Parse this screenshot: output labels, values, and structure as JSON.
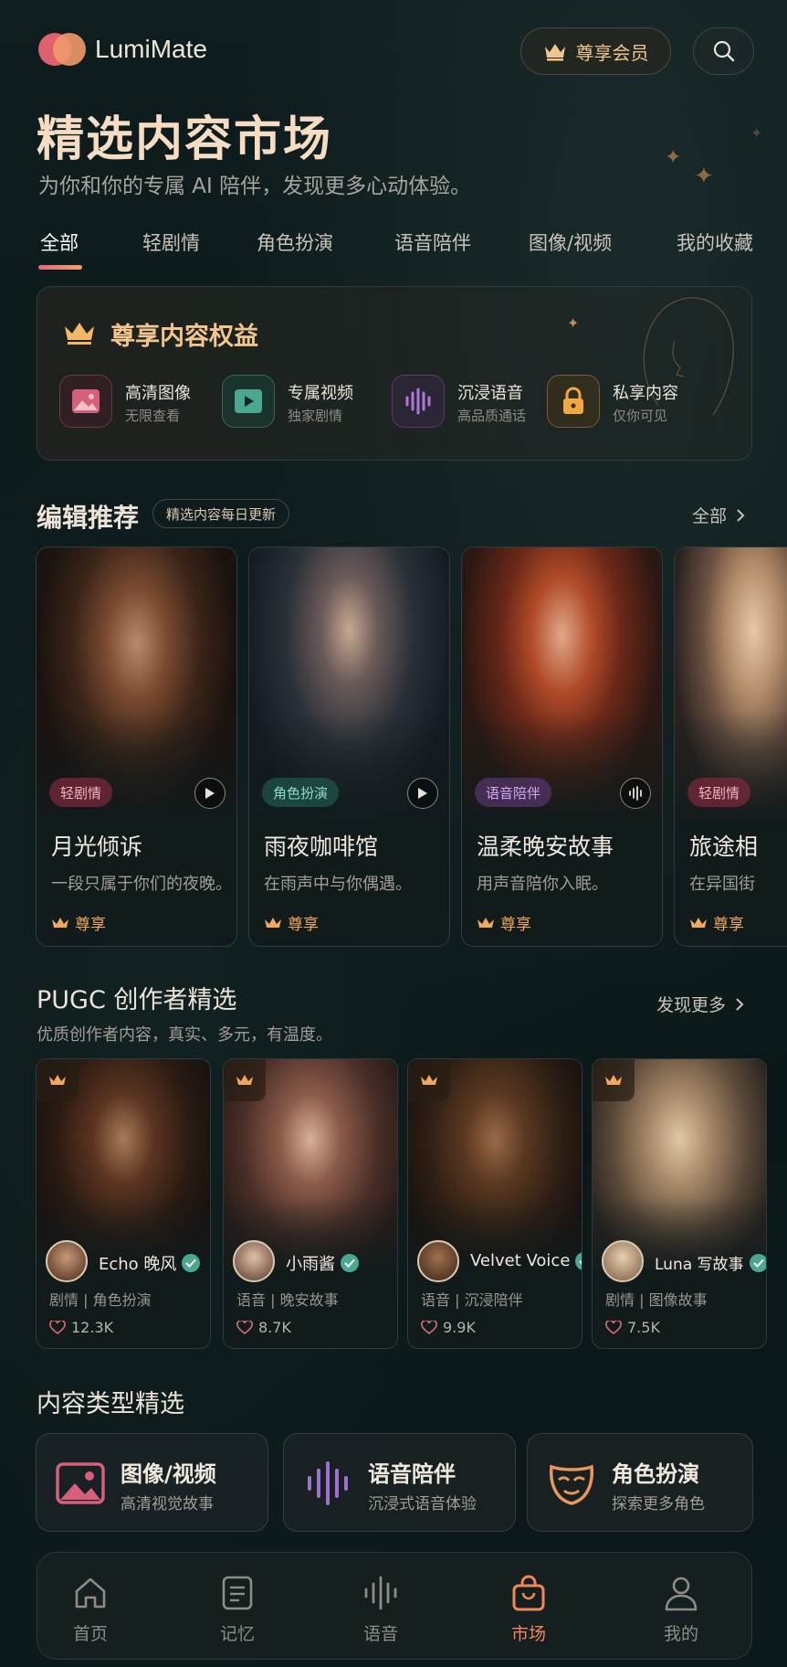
{
  "app": {
    "brand": "LumiMate"
  },
  "header": {
    "vip_label": "尊享会员"
  },
  "page": {
    "title": "精选内容市场",
    "subtitle": "为你和你的专属 AI 陪伴，发现更多心动体验。"
  },
  "tabs": [
    {
      "label": "全部",
      "active": true
    },
    {
      "label": "轻剧情"
    },
    {
      "label": "角色扮演"
    },
    {
      "label": "语音陪伴"
    },
    {
      "label": "图像/视频"
    },
    {
      "label": "我的收藏"
    }
  ],
  "benefits": {
    "title": "尊享内容权益",
    "items": [
      {
        "name": "高清图像",
        "sub": "无限查看",
        "icon": "image-icon"
      },
      {
        "name": "专属视频",
        "sub": "独家剧情",
        "icon": "play-icon"
      },
      {
        "name": "沉浸语音",
        "sub": "高品质通话",
        "icon": "waveform-icon"
      },
      {
        "name": "私享内容",
        "sub": "仅你可见",
        "icon": "lock-icon"
      }
    ]
  },
  "editor": {
    "title": "编辑推荐",
    "pill": "精选内容每日更新",
    "more": "全部",
    "cards": [
      {
        "tag": "轻剧情",
        "name": "月光倾诉",
        "desc": "一段只属于你们的夜晚。",
        "vip": "尊享",
        "action_icon": "play-icon"
      },
      {
        "tag": "角色扮演",
        "name": "雨夜咖啡馆",
        "desc": "在雨声中与你偶遇。",
        "vip": "尊享",
        "action_icon": "play-icon"
      },
      {
        "tag": "语音陪伴",
        "name": "温柔晚安故事",
        "desc": "用声音陪你入眠。",
        "vip": "尊享",
        "action_icon": "waveform-icon"
      },
      {
        "tag": "轻剧情",
        "name": "旅途相",
        "desc": "在异国街",
        "vip": "尊享",
        "action_icon": ""
      }
    ]
  },
  "pugc": {
    "title": "PUGC 创作者精选",
    "subtitle": "优质创作者内容，真实、多元，有温度。",
    "more": "发现更多",
    "cards": [
      {
        "author": "Echo 晚风",
        "cats": "剧情 | 角色扮演",
        "likes": "12.3K"
      },
      {
        "author": "小雨酱",
        "cats": "语音 | 晚安故事",
        "likes": "8.7K"
      },
      {
        "author": "Velvet Voice",
        "cats": "语音 | 沉浸陪伴",
        "likes": "9.9K"
      },
      {
        "author": "Luna 写故事",
        "cats": "剧情 | 图像故事",
        "likes": "7.5K"
      }
    ]
  },
  "types": {
    "title": "内容类型精选",
    "items": [
      {
        "name": "图像/视频",
        "sub": "高清视觉故事",
        "icon": "image-icon"
      },
      {
        "name": "语音陪伴",
        "sub": "沉浸式语音体验",
        "icon": "waveform-icon"
      },
      {
        "name": "角色扮演",
        "sub": "探索更多角色",
        "icon": "mask-icon"
      }
    ]
  },
  "nav": [
    {
      "label": "首页",
      "icon": "home-icon"
    },
    {
      "label": "记忆",
      "icon": "notes-icon"
    },
    {
      "label": "语音",
      "icon": "waveform-icon"
    },
    {
      "label": "市场",
      "icon": "bag-icon",
      "active": true
    },
    {
      "label": "我的",
      "icon": "user-icon"
    }
  ],
  "colors": {
    "accent": "#f0865a",
    "gold": "#f2c58e",
    "background": "#0c1a1b"
  }
}
